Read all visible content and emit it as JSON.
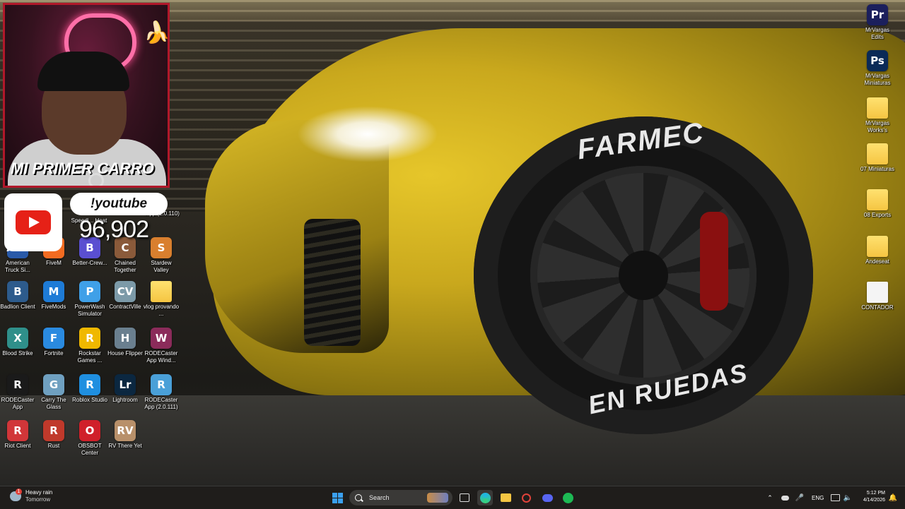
{
  "webcam": {
    "caption": "MI PRIMER CARRO"
  },
  "youtube_widget": {
    "command": "!youtube",
    "count": "96,902"
  },
  "wallpaper": {
    "tire_text_top": "FARMEC",
    "tire_text_bottom": "EN RUEDAS"
  },
  "left_icons": [
    {
      "label": "American Truck Si...",
      "icon": "truck-icon",
      "color": "#2a5aa8",
      "glyph": "ATS"
    },
    {
      "label": "FiveM",
      "icon": "fivem-icon",
      "color": "#f26b21",
      "glyph": "F"
    },
    {
      "label": "Better-Crew...",
      "icon": "app-icon",
      "color": "#5a4fd1",
      "glyph": "B"
    },
    {
      "label": "Chained Together",
      "icon": "game-icon",
      "color": "#8a5a3a",
      "glyph": "C"
    },
    {
      "label": "Stardew Valley",
      "icon": "game-icon",
      "color": "#d97f2e",
      "glyph": "S"
    },
    {
      "label": "Badlion Client",
      "icon": "badlion-icon",
      "color": "#2d5b8c",
      "glyph": "B"
    },
    {
      "label": "FiveMods",
      "icon": "fivemods-icon",
      "color": "#1e7bd6",
      "glyph": "M"
    },
    {
      "label": "PowerWash Simulator",
      "icon": "powerwash-icon",
      "color": "#3fa0e8",
      "glyph": "P"
    },
    {
      "label": "ContractVille",
      "icon": "contractville-icon",
      "color": "#7c9aa8",
      "glyph": "CV"
    },
    {
      "label": "vlog provando ...",
      "icon": "folder-icon",
      "color": "#f5c542",
      "glyph": ""
    },
    {
      "label": "Blood Strike",
      "icon": "game-icon",
      "color": "#2f8f8a",
      "glyph": "X"
    },
    {
      "label": "Fortnite",
      "icon": "fortnite-icon",
      "color": "#2a8ae0",
      "glyph": "F"
    },
    {
      "label": "Rockstar Games ...",
      "icon": "rockstar-icon",
      "color": "#f0b800",
      "glyph": "R"
    },
    {
      "label": "House Flipper",
      "icon": "game-icon",
      "color": "#6a7f8f",
      "glyph": "H"
    },
    {
      "label": "RODECaster App Wind...",
      "icon": "winrar-icon",
      "color": "#8b2b5a",
      "glyph": "W"
    },
    {
      "label": "RODECaster App",
      "icon": "rodecaster-icon",
      "color": "#1a1a1a",
      "glyph": "R"
    },
    {
      "label": "Carry The Glass",
      "icon": "game-icon",
      "color": "#6fa0c0",
      "glyph": "G"
    },
    {
      "label": "Roblox Studio",
      "icon": "roblox-icon",
      "color": "#1f8fe0",
      "glyph": "R"
    },
    {
      "label": "Lightroom",
      "icon": "lightroom-icon",
      "color": "#0b2740",
      "glyph": "Lr"
    },
    {
      "label": "RODECaster App (2.0.111)",
      "icon": "installer-icon",
      "color": "#4aa0d8",
      "glyph": "R"
    },
    {
      "label": "Riot Client",
      "icon": "riot-icon",
      "color": "#d13639",
      "glyph": "R"
    },
    {
      "label": "Rust",
      "icon": "rust-icon",
      "color": "#c0392b",
      "glyph": "R"
    },
    {
      "label": "OBSBOT Center",
      "icon": "obsbot-icon",
      "color": "#d0202a",
      "glyph": "O"
    },
    {
      "label": "RV There Yet",
      "icon": "game-icon",
      "color": "#b8906a",
      "glyph": "RV"
    }
  ],
  "partial_icons": [
    {
      "label": "App (2.0.110)"
    },
    {
      "label": "Speedi... Heat"
    }
  ],
  "right_icons": [
    {
      "label": "MrVargas Edits",
      "icon": "premiere-icon",
      "color": "#1b1f5c",
      "glyph": "Pr"
    },
    {
      "label": "MrVargas Miniaturas",
      "icon": "photoshop-icon",
      "color": "#0a2a57",
      "glyph": "Ps"
    },
    {
      "label": "MrVargas Works's",
      "icon": "folder-icon",
      "color": "#f5c542",
      "glyph": ""
    },
    {
      "label": "07 Miniaturas",
      "icon": "folder-icon",
      "color": "#f5c542",
      "glyph": ""
    },
    {
      "label": "08 Exports",
      "icon": "folder-icon",
      "color": "#f5c542",
      "glyph": ""
    },
    {
      "label": "Andeseat",
      "icon": "folder-icon",
      "color": "#f5c542",
      "glyph": ""
    },
    {
      "label": "CONTADOR",
      "icon": "text-file-icon",
      "color": "#f4f4f4",
      "glyph": ""
    }
  ],
  "taskbar": {
    "weather": {
      "title": "Heavy rain",
      "subtitle": "Tomorrow",
      "badge": "1"
    },
    "search_placeholder": "Search",
    "language": "ENG",
    "time": "5:12 PM",
    "date": "4/14/2026"
  }
}
